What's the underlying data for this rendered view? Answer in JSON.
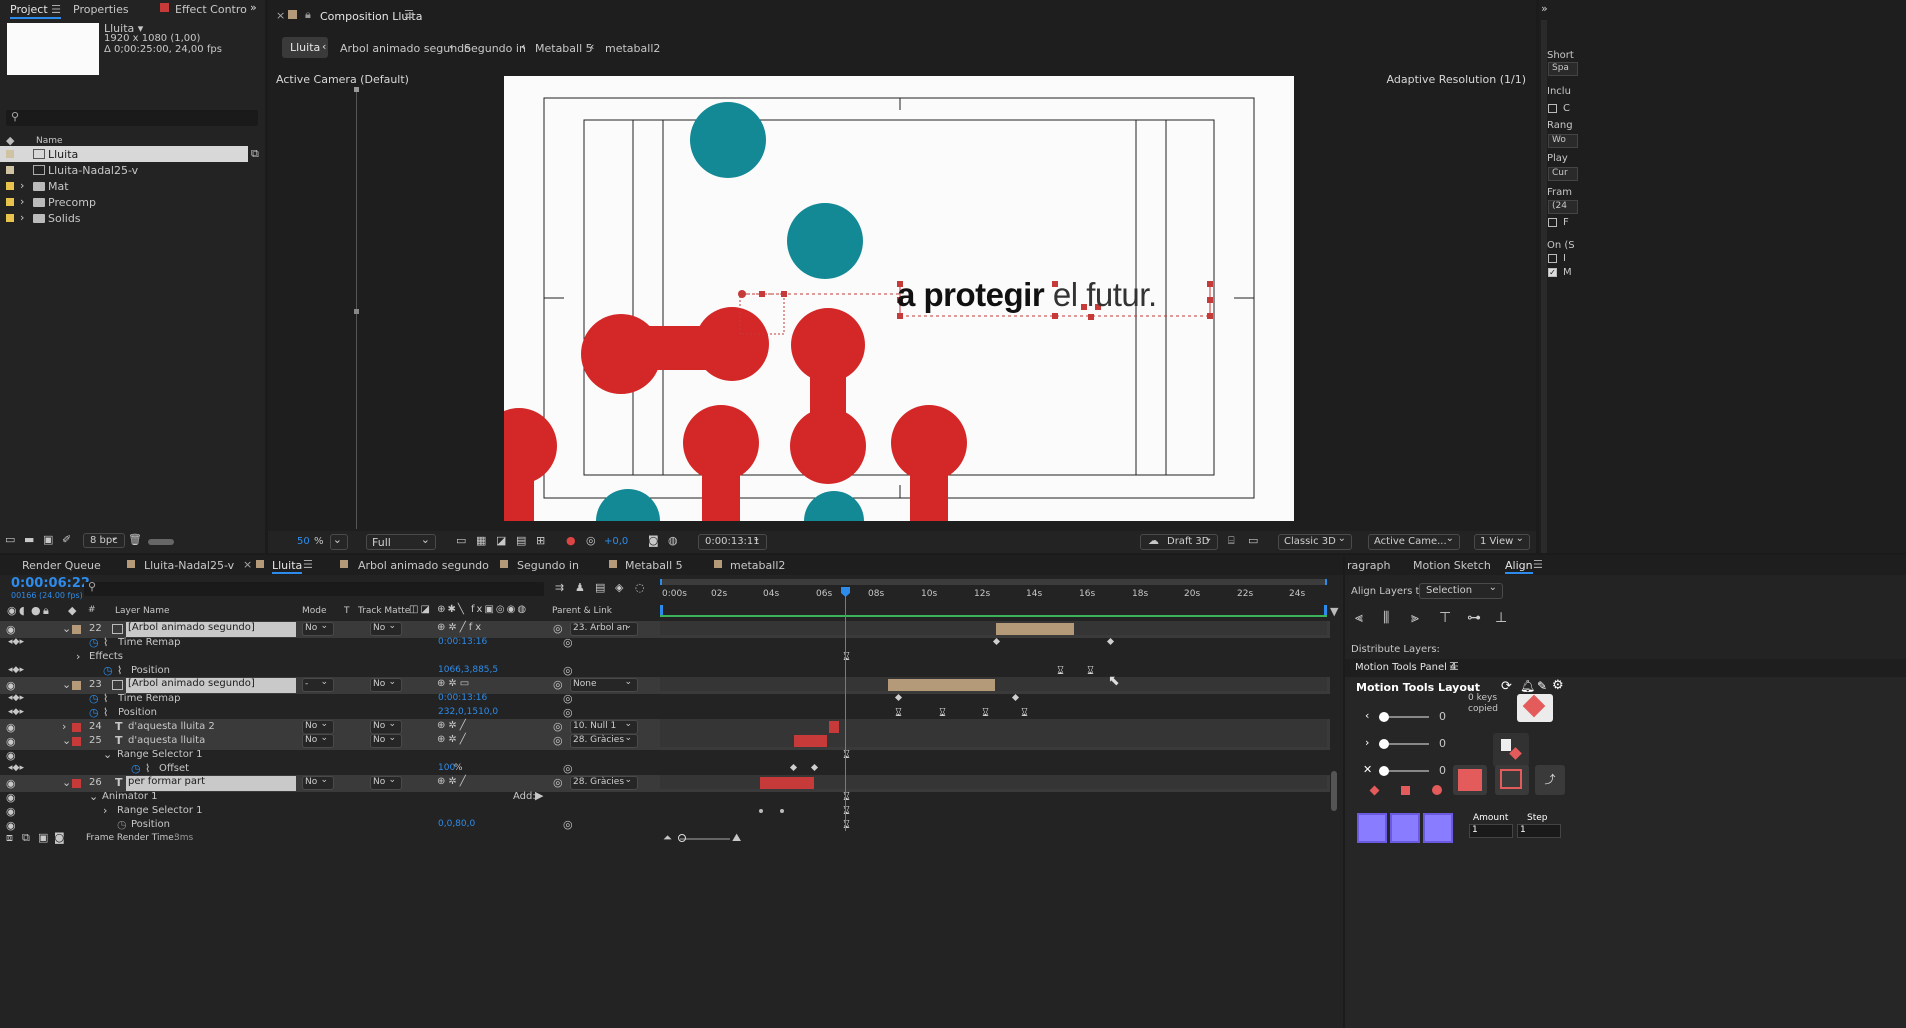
{
  "project_panel": {
    "tabs": [
      "Project",
      "Properties",
      "Effect Controls Gi"
    ],
    "comp_name": "Lluita ▾",
    "comp_size": "1920 x 1080 (1,00)",
    "comp_duration": "Δ 0;00:25:00, 24,00 fps",
    "search_placeholder": "",
    "name_header": "Name",
    "items": [
      {
        "name": "Lluita",
        "color": "#cfc3a2",
        "kind": "comp",
        "selected": true
      },
      {
        "name": "Lluita-Nadal25-v",
        "color": "#cfc3a2",
        "kind": "comp",
        "selected": false
      },
      {
        "name": "Mat",
        "color": "#e8c24a",
        "kind": "folder",
        "selected": false
      },
      {
        "name": "Precomp",
        "color": "#e8c24a",
        "kind": "folder",
        "selected": false
      },
      {
        "name": "Solids",
        "color": "#e8c24a",
        "kind": "folder",
        "selected": false
      }
    ],
    "bpc": "8 bpc"
  },
  "composition": {
    "tab_title": "Composition Lluita",
    "breadcrumbs": [
      "Lluita",
      "Arbol animado segundo",
      "Segundo in",
      "Metaball 5",
      "metaball2"
    ],
    "active_camera": "Active Camera (Default)",
    "adaptive": "Adaptive Resolution (1/1)",
    "canvas_text_bold": "a protegir",
    "canvas_text_light": "el futur.",
    "zoom": "50",
    "zoom_unit": "%",
    "resolution": "Full",
    "exposure": "+0,0",
    "timecode": "0:00:13:11",
    "draft3d": "Draft 3D",
    "renderer": "Classic 3D",
    "camera": "Active Came...",
    "views": "1 View"
  },
  "right_panel": {
    "labels": [
      "Short",
      "Spa",
      "Inclu",
      "C",
      "Rang",
      "Wo",
      "Play",
      "Cur",
      "Fram",
      "(24",
      "F",
      "On (S",
      "I",
      "M"
    ]
  },
  "timeline": {
    "tabs": [
      "Render Queue",
      "Lluita-Nadal25-v",
      "Lluita",
      "Arbol animado segundo",
      "Segundo in",
      "Metaball 5",
      "metaball2"
    ],
    "active_tab": "Lluita",
    "current_time": "0:00:06:22",
    "frame_info": "00166 (24.00 fps)",
    "col_layer_name": "Layer Name",
    "col_mode": "Mode",
    "col_t": "T",
    "col_track_matte": "Track Matte",
    "col_parent": "Parent & Link",
    "ruler": [
      "0:00s",
      "02s",
      "04s",
      "06s",
      "08s",
      "10s",
      "12s",
      "14s",
      "16s",
      "18s",
      "20s",
      "22s",
      "24s"
    ],
    "rows": [
      {
        "num": "22",
        "name": "[Arbol animado segundo]",
        "mode": "No",
        "matte": "No",
        "parent": "23. Arbol an",
        "layer": true,
        "color": "#b59a7a"
      },
      {
        "name": "Time Remap",
        "value": "0:00:13:16"
      },
      {
        "name": "Effects"
      },
      {
        "name": "Position",
        "value": "1066,3,885,5"
      },
      {
        "num": "23",
        "name": "[Arbol animado segundo]",
        "mode": "-",
        "matte": "No",
        "parent": "None",
        "layer": true,
        "color": "#b59a7a"
      },
      {
        "name": "Time Remap",
        "value": "0:00:13:16"
      },
      {
        "name": "Position",
        "value": "232,0,1510,0"
      },
      {
        "num": "24",
        "name": "d'aquesta lluita 2",
        "mode": "No",
        "matte": "No",
        "parent": "10. Null 1",
        "layer": true,
        "color": "#c73a3a"
      },
      {
        "num": "25",
        "name": "d'aquesta lluita",
        "mode": "No",
        "matte": "No",
        "parent": "28. Gràcies",
        "layer": true,
        "color": "#c73a3a"
      },
      {
        "name": "Range Selector 1"
      },
      {
        "name": "Offset",
        "value": "100",
        "unit": "%"
      },
      {
        "num": "26",
        "name": "per formar part",
        "mode": "No",
        "matte": "No",
        "parent": "28. Gràcies",
        "layer": true,
        "color": "#c73a3a"
      },
      {
        "name": "Animator 1",
        "add": "Add:"
      },
      {
        "name": "Range Selector 1"
      },
      {
        "name": "Position",
        "value": "0,0,80,0"
      }
    ],
    "frame_render_time_label": "Frame Render Time:",
    "frame_render_time": "3ms"
  },
  "align_panel": {
    "tabs": [
      "ragraph",
      "Motion Sketch",
      "Align"
    ],
    "align_layers_to_label": "Align Layers to:",
    "align_layers_to": "Selection",
    "distribute_label": "Distribute Layers:"
  },
  "motion_tools": {
    "panel_title": "Motion Tools Panel 4",
    "layout_label": "Motion Tools Layout",
    "keys_copied": "0 keys copied",
    "slider_values": [
      "0",
      "0",
      "0"
    ],
    "amount_label": "Amount",
    "step_label": "Step",
    "amount": "1",
    "step": "1"
  }
}
